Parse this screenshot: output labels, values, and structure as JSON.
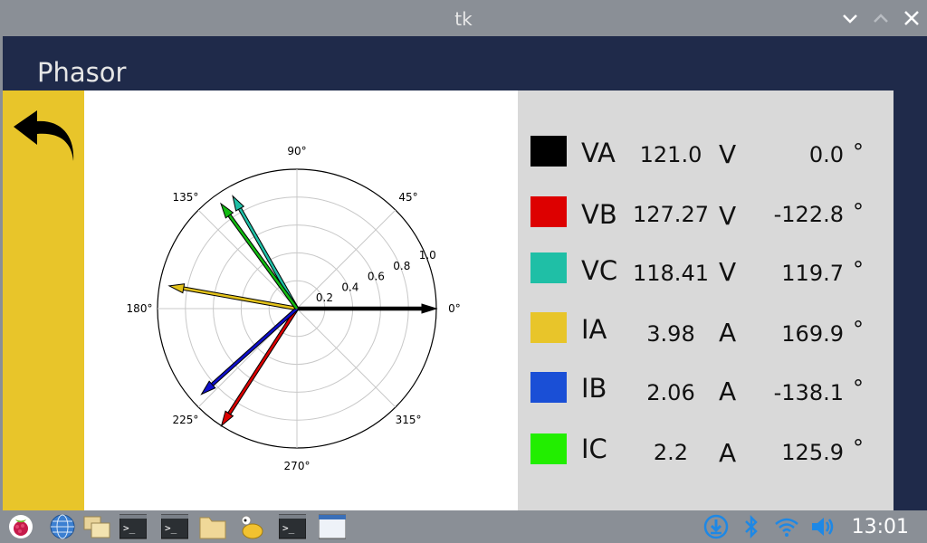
{
  "window": {
    "title": "tk"
  },
  "header": {
    "title": "Phasor"
  },
  "polar": {
    "angle_labels": [
      "0°",
      "45°",
      "90°",
      "135°",
      "180°",
      "225°",
      "270°",
      "315°"
    ],
    "radial_labels": [
      "0.2",
      "0.4",
      "0.6",
      "0.8",
      "1.0"
    ],
    "vectors": [
      {
        "name": "VA",
        "magnitude": 1.0,
        "angle": 0.0,
        "color": "#000000"
      },
      {
        "name": "VB",
        "magnitude": 1.0,
        "angle": -122.8,
        "color": "#dd0000"
      },
      {
        "name": "VC",
        "magnitude": 0.93,
        "angle": 119.7,
        "color": "#1fbfa6"
      },
      {
        "name": "IA",
        "magnitude": 0.93,
        "angle": 169.9,
        "color": "#e3c21a"
      },
      {
        "name": "IB",
        "magnitude": 0.92,
        "angle": -138.1,
        "color": "#1010cc"
      },
      {
        "name": "IC",
        "magnitude": 0.93,
        "angle": 125.9,
        "color": "#11bb11"
      }
    ]
  },
  "readout": {
    "rows": [
      {
        "label": "VA",
        "value": "121.0",
        "unit": "V",
        "angle": "0.0",
        "deg": "°",
        "color": "#000000"
      },
      {
        "label": "VB",
        "value": "127.27",
        "unit": "V",
        "angle": "-122.8",
        "deg": "°",
        "color": "#dd0000"
      },
      {
        "label": "VC",
        "value": "118.41",
        "unit": "V",
        "angle": "119.7",
        "deg": "°",
        "color": "#1fbfa6"
      },
      {
        "label": "IA",
        "value": "3.98",
        "unit": "A",
        "angle": "169.9",
        "deg": "°",
        "color": "#e8c52a"
      },
      {
        "label": "IB",
        "value": "2.06",
        "unit": "A",
        "angle": "-138.1",
        "deg": "°",
        "color": "#1a4fd6"
      },
      {
        "label": "IC",
        "value": "2.2",
        "unit": "A",
        "angle": "125.9",
        "deg": "°",
        "color": "#22ee00"
      }
    ]
  },
  "taskbar": {
    "clock": "13:01",
    "icons": [
      "raspberry-menu-icon",
      "web-browser-icon",
      "file-manager-icon",
      "terminal-icon",
      "terminal-icon",
      "folder-icon",
      "python-ide-icon",
      "terminal-icon",
      "window-icon",
      "download-icon",
      "bluetooth-icon",
      "wifi-icon",
      "volume-icon"
    ]
  }
}
